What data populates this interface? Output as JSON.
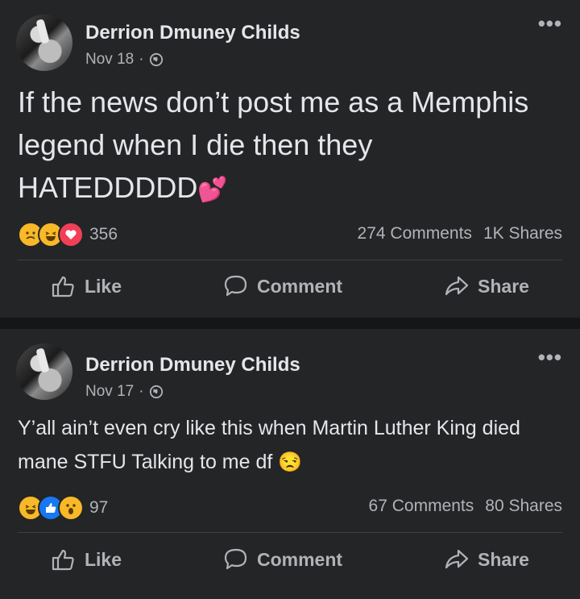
{
  "posts": [
    {
      "author": "Derrion Dmuney Childs",
      "date": "Nov 18",
      "text": "If the news don’t post me as a Memphis legend when I die then they HATEDDDDD",
      "trailing_emoji": "💕",
      "reaction_icons": [
        "sad-emoji",
        "haha-emoji",
        "love-heart"
      ],
      "reaction_count": "356",
      "comments": "274 Comments",
      "shares": "1K Shares"
    },
    {
      "author": "Derrion Dmuney Childs",
      "date": "Nov 17",
      "text": "Y’all ain’t even cry like this when Martin Luther King died mane STFU Talking to me df",
      "trailing_emoji": "😒",
      "reaction_icons": [
        "haha-emoji",
        "like-thumb",
        "wow-emoji"
      ],
      "reaction_count": "97",
      "comments": "67 Comments",
      "shares": "80 Shares"
    }
  ],
  "actions": {
    "like": "Like",
    "comment": "Comment",
    "share": "Share"
  },
  "colors": {
    "page_bg": "#161618",
    "card_bg": "#242526",
    "primary_text": "#e4e6eb",
    "secondary_text": "#b0b3b8",
    "love": "#f33e58",
    "like": "#1877f2",
    "emoji_yellow": "#f7b928"
  }
}
